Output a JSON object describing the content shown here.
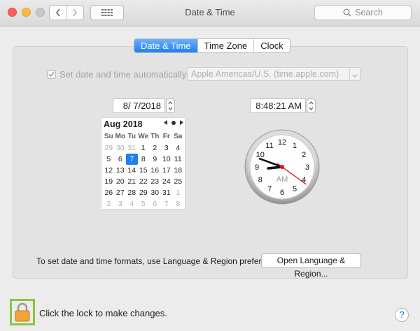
{
  "window": {
    "title": "Date & Time"
  },
  "toolbar": {
    "search_placeholder": "Search"
  },
  "tabs": [
    {
      "label": "Date & Time",
      "active": true
    },
    {
      "label": "Time Zone",
      "active": false
    },
    {
      "label": "Clock",
      "active": false
    }
  ],
  "auto": {
    "label": "Set date and time automatically:",
    "checked": true,
    "server": "Apple Americas/U.S. (time.apple.com)"
  },
  "date_field": "8/  7/2018",
  "time_field": "8:48:21 AM",
  "calendar": {
    "title": "Aug 2018",
    "weekdays": [
      "Su",
      "Mo",
      "Tu",
      "We",
      "Th",
      "Fr",
      "Sa"
    ],
    "days": [
      [
        "29",
        "30",
        "31",
        "1",
        "2",
        "3",
        "4"
      ],
      [
        "5",
        "6",
        "7",
        "8",
        "9",
        "10",
        "11"
      ],
      [
        "12",
        "13",
        "14",
        "15",
        "16",
        "17",
        "18"
      ],
      [
        "19",
        "20",
        "21",
        "22",
        "23",
        "24",
        "25"
      ],
      [
        "26",
        "27",
        "28",
        "29",
        "30",
        "31",
        "1"
      ],
      [
        "2",
        "3",
        "4",
        "5",
        "6",
        "7",
        "8"
      ]
    ],
    "selected_day": "7"
  },
  "clock": {
    "numbers": [
      "12",
      "1",
      "2",
      "3",
      "4",
      "5",
      "6",
      "7",
      "8",
      "9",
      "10",
      "11"
    ],
    "meridiem": "AM",
    "hour": 8,
    "minute": 48,
    "second": 21
  },
  "formats_text": "To set date and time formats, use Language & Region preferences.",
  "open_language_button": "Open Language & Region...",
  "lock_text": "Click the lock to make changes.",
  "help_label": "?",
  "colors": {
    "accent": "#1f7ff1",
    "lock_highlight": "#8ac63f",
    "lock_body": "#f0a43a"
  }
}
